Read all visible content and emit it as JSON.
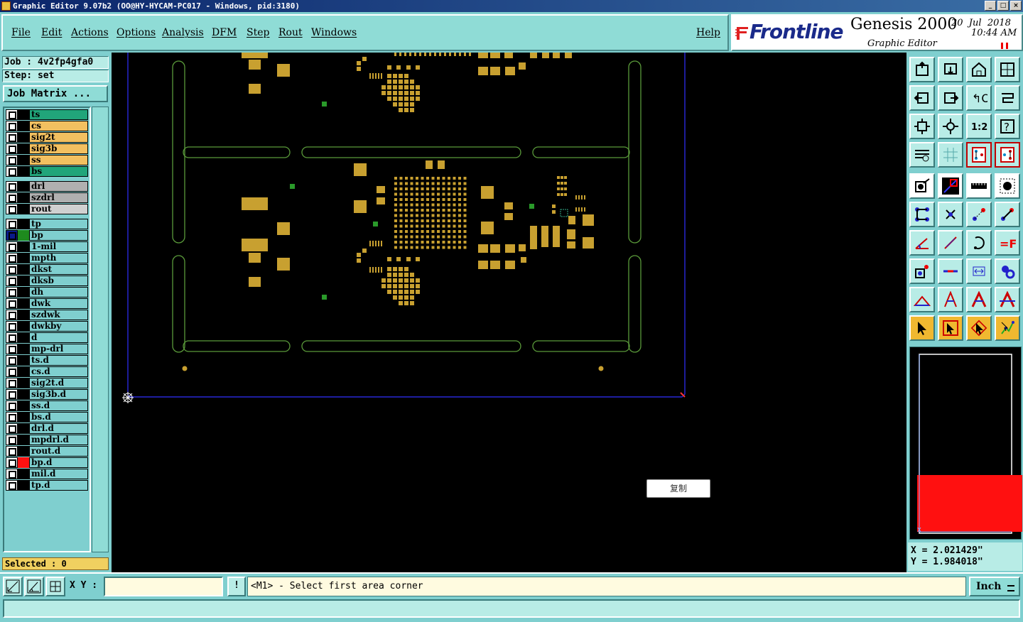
{
  "window": {
    "title": "Graphic Editor 9.07b2 (OO@HY-HYCAM-PC017 - Windows, pid:3180)"
  },
  "menu": [
    "File",
    "Edit",
    "Actions",
    "Options",
    "Analysis",
    "DFM",
    "Step",
    "Rout",
    "Windows"
  ],
  "help": "Help",
  "brand": {
    "logo": "Frontline",
    "product": "Genesis 2000",
    "date": "20  Jul  2018",
    "time": "10:44 AM",
    "subtitle": "Graphic Editor"
  },
  "job": {
    "job_label": "Job : 4v2fp4gfa0",
    "step_label": "Step: set",
    "matrix_button": "Job Matrix ..."
  },
  "layers": [
    {
      "name": "ts",
      "bg": "#21a57a",
      "swatch": "#000"
    },
    {
      "name": "cs",
      "bg": "#f2c060",
      "swatch": "#000"
    },
    {
      "name": "sig2t",
      "bg": "#f2c060",
      "swatch": "#000"
    },
    {
      "name": "sig3b",
      "bg": "#f2c060",
      "swatch": "#000"
    },
    {
      "name": "ss",
      "bg": "#f2c060",
      "swatch": "#000"
    },
    {
      "name": "bs",
      "bg": "#21a57a",
      "swatch": "#000"
    },
    {
      "name": "drl",
      "bg": "#b0b0b0",
      "swatch": "#000",
      "gap": true
    },
    {
      "name": "szdrl",
      "bg": "#b0b0b0",
      "swatch": "#000"
    },
    {
      "name": "rout",
      "bg": "#d0d0d0",
      "swatch": "#000"
    },
    {
      "name": "tp",
      "bg": "#7fcfcf",
      "swatch": "#000",
      "gap": true
    },
    {
      "name": "bp",
      "bg": "#7fcfcf",
      "swatch": "#1e8a1e",
      "selected": true
    },
    {
      "name": "1-mil",
      "bg": "#7fcfcf",
      "swatch": "#000"
    },
    {
      "name": "mpth",
      "bg": "#7fcfcf",
      "swatch": "#000"
    },
    {
      "name": "dkst",
      "bg": "#7fcfcf",
      "swatch": "#000"
    },
    {
      "name": "dksb",
      "bg": "#7fcfcf",
      "swatch": "#000"
    },
    {
      "name": "dh",
      "bg": "#7fcfcf",
      "swatch": "#000"
    },
    {
      "name": "dwk",
      "bg": "#7fcfcf",
      "swatch": "#000"
    },
    {
      "name": "szdwk",
      "bg": "#7fcfcf",
      "swatch": "#000"
    },
    {
      "name": "dwkby",
      "bg": "#7fcfcf",
      "swatch": "#000"
    },
    {
      "name": "d",
      "bg": "#7fcfcf",
      "swatch": "#000"
    },
    {
      "name": "mp-drl",
      "bg": "#7fcfcf",
      "swatch": "#000"
    },
    {
      "name": "ts.d",
      "bg": "#7fcfcf",
      "swatch": "#000"
    },
    {
      "name": "cs.d",
      "bg": "#7fcfcf",
      "swatch": "#000"
    },
    {
      "name": "sig2t.d",
      "bg": "#7fcfcf",
      "swatch": "#000"
    },
    {
      "name": "sig3b.d",
      "bg": "#7fcfcf",
      "swatch": "#000"
    },
    {
      "name": "ss.d",
      "bg": "#7fcfcf",
      "swatch": "#000"
    },
    {
      "name": "bs.d",
      "bg": "#7fcfcf",
      "swatch": "#000"
    },
    {
      "name": "drl.d",
      "bg": "#7fcfcf",
      "swatch": "#000"
    },
    {
      "name": "mpdrl.d",
      "bg": "#7fcfcf",
      "swatch": "#000"
    },
    {
      "name": "rout.d",
      "bg": "#7fcfcf",
      "swatch": "#000"
    },
    {
      "name": "bp.d",
      "bg": "#7fcfcf",
      "swatch": "#ff1010"
    },
    {
      "name": "mil.d",
      "bg": "#7fcfcf",
      "swatch": "#000"
    },
    {
      "name": "tp.d",
      "bg": "#7fcfcf",
      "swatch": "#000"
    }
  ],
  "selected_label": "Selected : 0",
  "copy_popup": "复制",
  "coords": {
    "x": "X = 2.021429\"",
    "y": "Y = 1.984018\""
  },
  "bottom": {
    "xy_label": "X Y :",
    "xy_value": "",
    "exclaim": "!",
    "prompt": "<M1> - Select first area corner",
    "units": "Inch"
  },
  "colors": {
    "copper": "#c8a030",
    "board_outline": "#3030ff",
    "rout": "#5a9a3a",
    "teal": "#7fcfcf"
  }
}
